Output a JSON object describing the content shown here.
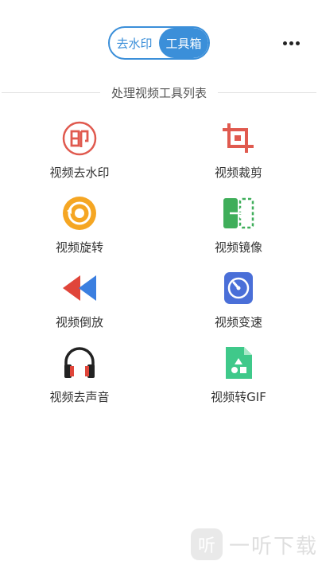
{
  "header": {
    "tabs": [
      {
        "label": "去水印",
        "active": false
      },
      {
        "label": "工具箱",
        "active": true
      }
    ]
  },
  "section": {
    "title": "处理视频工具列表"
  },
  "tools": [
    {
      "label": "视频去水印",
      "icon": "stamp-icon",
      "color": "#e05a4f"
    },
    {
      "label": "视频裁剪",
      "icon": "crop-icon",
      "color": "#e05a4f"
    },
    {
      "label": "视频旋转",
      "icon": "rotate-icon",
      "color": "#f5a623"
    },
    {
      "label": "视频镜像",
      "icon": "mirror-icon",
      "color": "#3fae5a"
    },
    {
      "label": "视频倒放",
      "icon": "rewind-icon",
      "color": "#e0453a"
    },
    {
      "label": "视频变速",
      "icon": "speedometer-icon",
      "color": "#4a6fd8"
    },
    {
      "label": "视频去声音",
      "icon": "headphones-icon",
      "color": "#e0453a"
    },
    {
      "label": "视频转GIF",
      "icon": "image-file-icon",
      "color": "#3fc98a"
    }
  ],
  "watermark": {
    "logo": "听",
    "text": "一听下载"
  },
  "colors": {
    "accent": "#3b8fd9"
  }
}
